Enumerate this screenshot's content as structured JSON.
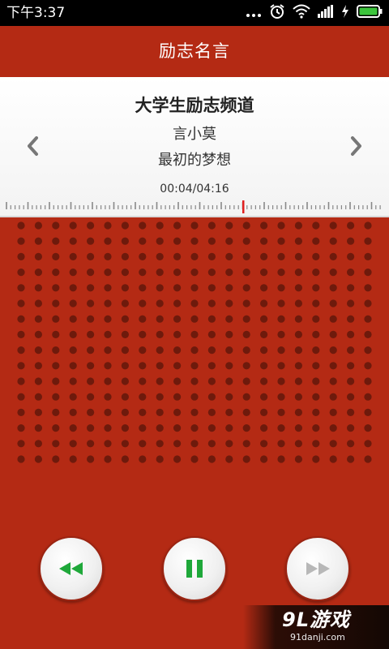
{
  "status_bar": {
    "time": "下午3:37",
    "icons": [
      "more-dots-icon",
      "alarm-clock-icon",
      "wifi-icon",
      "signal-icon",
      "charging-icon",
      "battery-icon"
    ],
    "battery_color": "#3cc43c"
  },
  "app_bar": {
    "title": "励志名言"
  },
  "now_playing": {
    "channel": "大学生励志频道",
    "artist": "言小莫",
    "song": "最初的梦想",
    "time_readout": "00:04/04:16",
    "progress_fraction": 0.016
  },
  "controls": {
    "rewind_icon": "rewind-icon",
    "pause_icon": "pause-icon",
    "fast_forward_icon": "fast-forward-icon",
    "active_color": "#1fa83a",
    "disabled_color": "#b8b8b8"
  },
  "watermark": {
    "main": "9L游戏",
    "sub": "91danji.com"
  },
  "colors": {
    "brand": "#b42a14",
    "grille_dot": "#6e1a0c",
    "needle": "#e02020"
  }
}
